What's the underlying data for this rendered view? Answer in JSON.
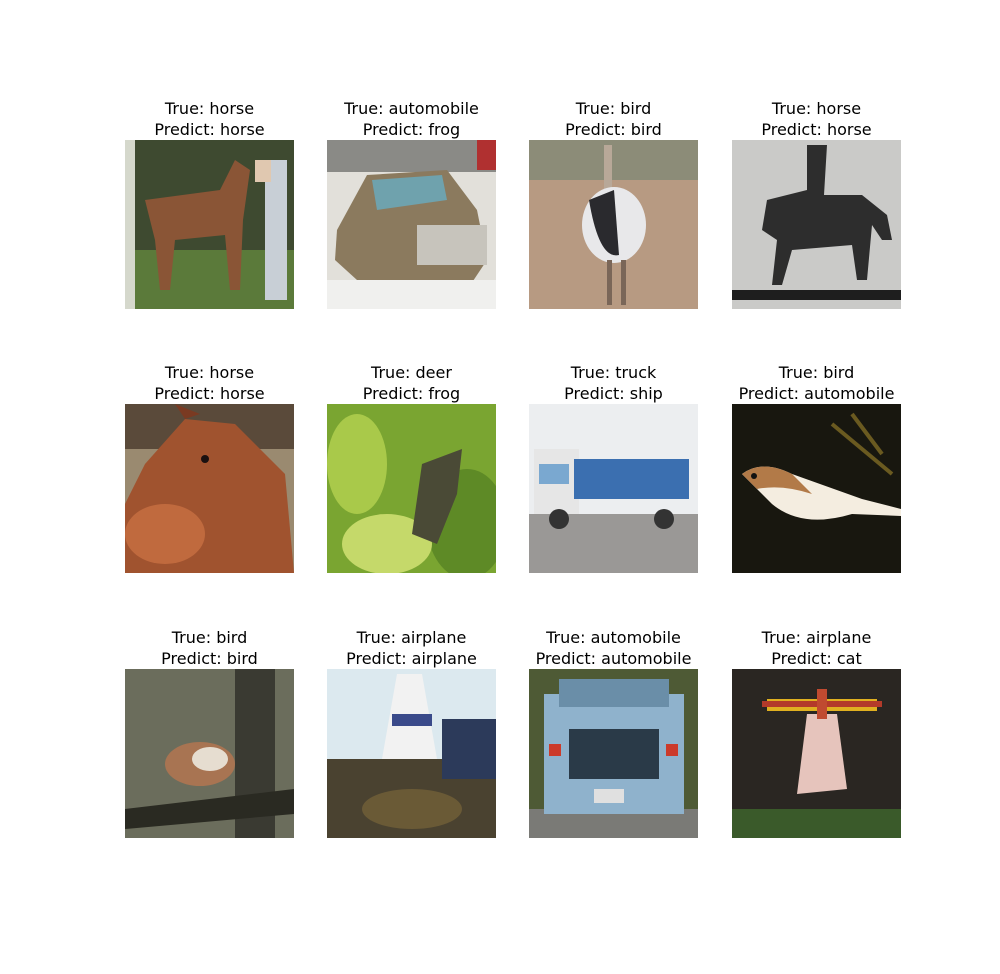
{
  "panels": [
    {
      "true_label": "True: horse",
      "predict_label": "Predict: horse",
      "image": "horse-with-person-photo",
      "palette": {
        "bg": "#4a5d35",
        "mid": "#8a5a3a",
        "accent": "#dde2e6"
      }
    },
    {
      "true_label": "True: automobile",
      "predict_label": "Predict: frog",
      "image": "vintage-car-photo",
      "palette": {
        "bg": "#d8d5cc",
        "mid": "#8b7a5e",
        "accent": "#6fa2ad"
      }
    },
    {
      "true_label": "True: bird",
      "predict_label": "Predict: bird",
      "image": "ostrich-photo",
      "palette": {
        "bg": "#b89a82",
        "mid": "#2a2a2e",
        "accent": "#e8e8ea"
      }
    },
    {
      "true_label": "True: horse",
      "predict_label": "Predict: horse",
      "image": "horse-silhouette-photo",
      "palette": {
        "bg": "#c9c9c7",
        "mid": "#2d2d2d",
        "accent": "#9e9e9c"
      }
    },
    {
      "true_label": "True: horse",
      "predict_label": "Predict: horse",
      "image": "brown-horse-head-photo",
      "palette": {
        "bg": "#9a8a70",
        "mid": "#a0532f",
        "accent": "#e0e0d8"
      }
    },
    {
      "true_label": "True: deer",
      "predict_label": "Predict: frog",
      "image": "deer-in-foliage-photo",
      "palette": {
        "bg": "#7aa531",
        "mid": "#4a5a2a",
        "accent": "#c5d96a"
      }
    },
    {
      "true_label": "True: truck",
      "predict_label": "Predict: ship",
      "image": "blue-truck-photo",
      "palette": {
        "bg": "#e2e4e6",
        "mid": "#3b6fb0",
        "accent": "#7a7a78"
      }
    },
    {
      "true_label": "True: bird",
      "predict_label": "Predict: automobile",
      "image": "bird-on-branch-dark-photo",
      "palette": {
        "bg": "#18170f",
        "mid": "#b27a48",
        "accent": "#f4ede0"
      }
    },
    {
      "true_label": "True: bird",
      "predict_label": "Predict: bird",
      "image": "sparrow-on-branch-photo",
      "palette": {
        "bg": "#6b6d5c",
        "mid": "#a87452",
        "accent": "#2a2a22"
      }
    },
    {
      "true_label": "True: airplane",
      "predict_label": "Predict: airplane",
      "image": "airplane-tail-photo",
      "palette": {
        "bg": "#dce9ef",
        "mid": "#4a4230",
        "accent": "#f2f2f2"
      }
    },
    {
      "true_label": "True: automobile",
      "predict_label": "Predict: automobile",
      "image": "blue-pickup-truck-photo",
      "palette": {
        "bg": "#4e5a35",
        "mid": "#8fb2cc",
        "accent": "#cc3a2a"
      }
    },
    {
      "true_label": "True: airplane",
      "predict_label": "Predict: cat",
      "image": "biplane-photo",
      "palette": {
        "bg": "#2a2622",
        "mid": "#d8a8a0",
        "accent": "#e0b020"
      }
    }
  ]
}
